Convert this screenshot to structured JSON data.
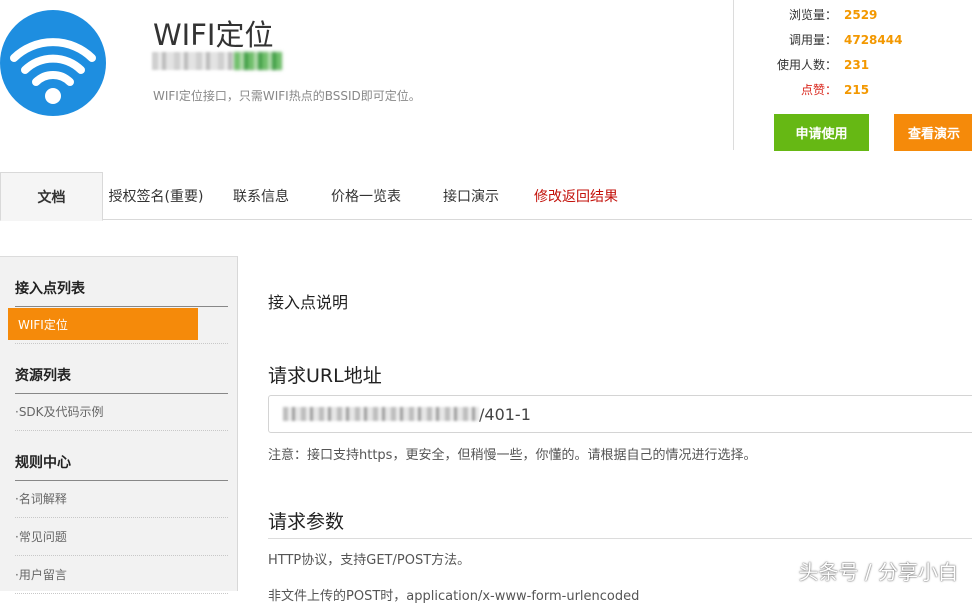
{
  "header": {
    "title": "WIFI定位",
    "description": "WIFI定位接口，只需WIFI热点的BSSID即可定位。",
    "logo_icon": "wifi-icon",
    "logo_color": "#1e8ee0"
  },
  "stats": [
    {
      "label": "浏览量：",
      "value": "2529"
    },
    {
      "label": "调用量：",
      "value": "4728444"
    },
    {
      "label": "使用人数：",
      "value": "231"
    },
    {
      "label": "点赞：",
      "value": "215"
    }
  ],
  "buttons": {
    "apply": "申请使用",
    "demo": "查看演示"
  },
  "tabs": [
    "文档",
    "授权签名(重要)",
    "联系信息",
    "价格一览表",
    "接口演示",
    "修改返回结果"
  ],
  "sidebar": {
    "sections": [
      {
        "title": "接入点列表",
        "items": [
          "WIFI定位"
        ]
      },
      {
        "title": "资源列表",
        "items": [
          "·SDK及代码示例"
        ]
      },
      {
        "title": "规则中心",
        "items": [
          "·名词解释",
          "·常见问题",
          "·用户留言"
        ]
      }
    ]
  },
  "main": {
    "access_title": "接入点说明",
    "url_title": "请求URL地址",
    "url_suffix": "/401-1",
    "note": "注意：接口支持https，更安全，但稍慢一些，你懂的。请根据自己的情况进行选择。",
    "params_title": "请求参数",
    "params_desc": "HTTP协议，支持GET/POST方法。",
    "cut_line": "非文件上传的POST时，application/x-www-form-urlencoded"
  },
  "watermark": "头条号 / 分享小白",
  "colors": {
    "accent_orange": "#f58a0a",
    "accent_green": "#66b814",
    "stat_orange": "#f39800",
    "highlight_red": "#c3120b"
  }
}
